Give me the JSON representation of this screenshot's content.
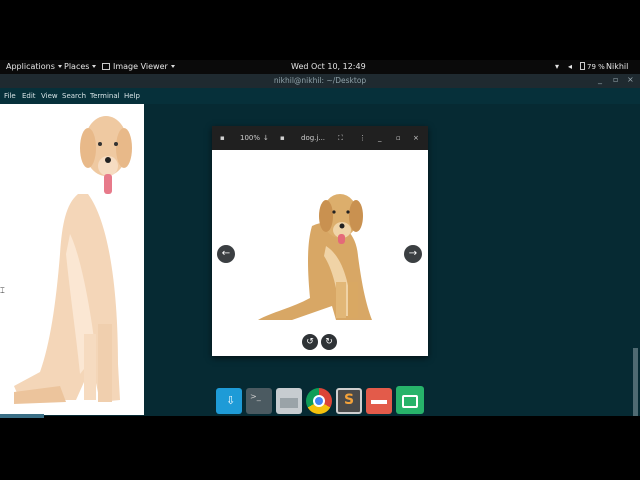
{
  "panel": {
    "applications": "Applications",
    "places": "Places",
    "image_viewer": "Image Viewer",
    "clock": "Wed Oct 10, 12:49",
    "battery": "79 %",
    "user": "Nikhil"
  },
  "terminal": {
    "title": "nikhil@nikhil: ~/Desktop",
    "menu": [
      "File",
      "Edit",
      "View",
      "Search",
      "Terminal",
      "Help"
    ]
  },
  "viewer": {
    "zoom": "100%",
    "filename": "dog.j...",
    "prev_icon": "arrow-left-icon",
    "next_icon": "arrow-right-icon"
  },
  "dock": {
    "apps": [
      "download-manager-icon",
      "terminal-icon",
      "files-icon",
      "chrome-icon",
      "sublime-text-icon",
      "slides-icon",
      "screen-recorder-icon"
    ]
  },
  "colors": {
    "terminal_bg": "#062a33",
    "accent": "#4fb3d9"
  }
}
